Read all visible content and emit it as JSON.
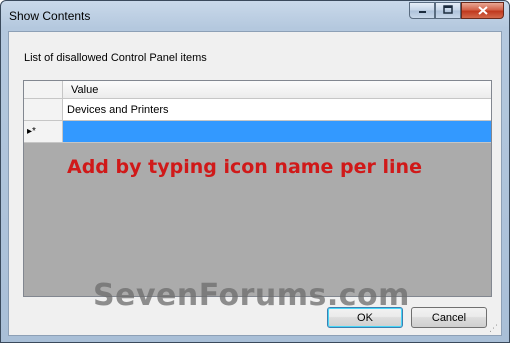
{
  "window": {
    "title": "Show Contents",
    "caption": {
      "minimize_icon": "minimize-icon",
      "maximize_icon": "maximize-icon",
      "close_icon": "close-icon"
    }
  },
  "dialog": {
    "list_label": "List of disallowed Control Panel items",
    "grid": {
      "column_header": "Value",
      "rows": [
        {
          "value": "Devices and Printers"
        }
      ],
      "new_row_marker": "▸*"
    },
    "annotation": "Add by typing icon name per line",
    "watermark": "SevenForums.com",
    "buttons": {
      "ok_label": "OK",
      "cancel_label": "Cancel"
    }
  },
  "colors": {
    "selection": "#3399ff",
    "annotation": "#d01919"
  }
}
